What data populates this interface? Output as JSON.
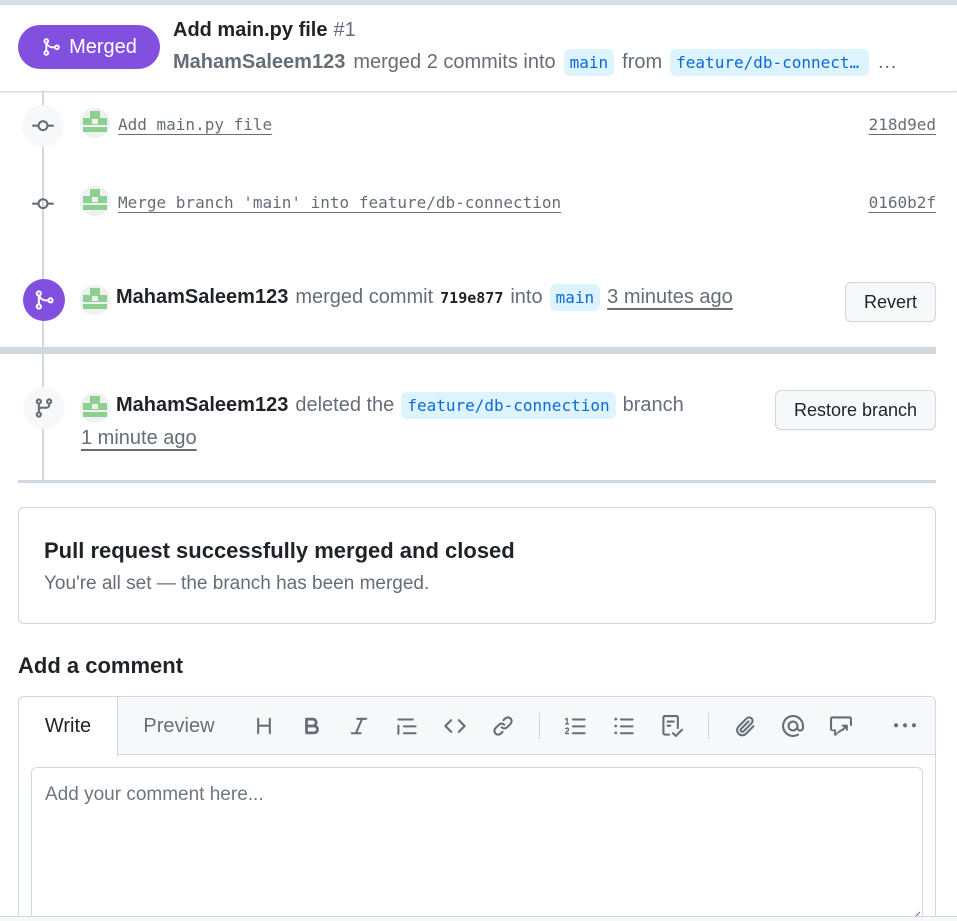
{
  "header": {
    "status_label": "Merged",
    "title": "Add main.py file",
    "number": "#1",
    "author": "MahamSaleem123",
    "action_text": "merged 2 commits into",
    "base_branch": "main",
    "from_text": "from",
    "head_branch": "feature/db-connection",
    "more": "…"
  },
  "commits": [
    {
      "message": "Add main.py file",
      "sha": "218d9ed"
    },
    {
      "message": "Merge branch 'main' into feature/db-connection",
      "sha": "0160b2f"
    }
  ],
  "merge_event": {
    "author": "MahamSaleem123",
    "action": "merged commit",
    "sha": "719e877",
    "into": "into",
    "branch": "main",
    "time": "3 minutes ago",
    "button": "Revert"
  },
  "delete_event": {
    "author": "MahamSaleem123",
    "action": "deleted the",
    "branch": "feature/db-connection",
    "suffix": "branch",
    "time": "1 minute ago",
    "button": "Restore branch"
  },
  "merged_box": {
    "title": "Pull request successfully merged and closed",
    "subtitle": "You're all set — the branch has been merged."
  },
  "comment": {
    "heading": "Add a comment",
    "tab_write": "Write",
    "tab_preview": "Preview",
    "placeholder": "Add your comment here..."
  },
  "colors": {
    "merged_purple": "#8250df",
    "branch_chip_bg": "#ddf4ff",
    "branch_chip_fg": "#0969da"
  },
  "icons": {
    "toolbar": [
      "heading-icon",
      "bold-icon",
      "italic-icon",
      "quote-icon",
      "code-icon",
      "link-icon",
      "ordered-list-icon",
      "unordered-list-icon",
      "task-list-icon",
      "attach-icon",
      "mention-icon",
      "reference-icon",
      "more-icon"
    ]
  }
}
